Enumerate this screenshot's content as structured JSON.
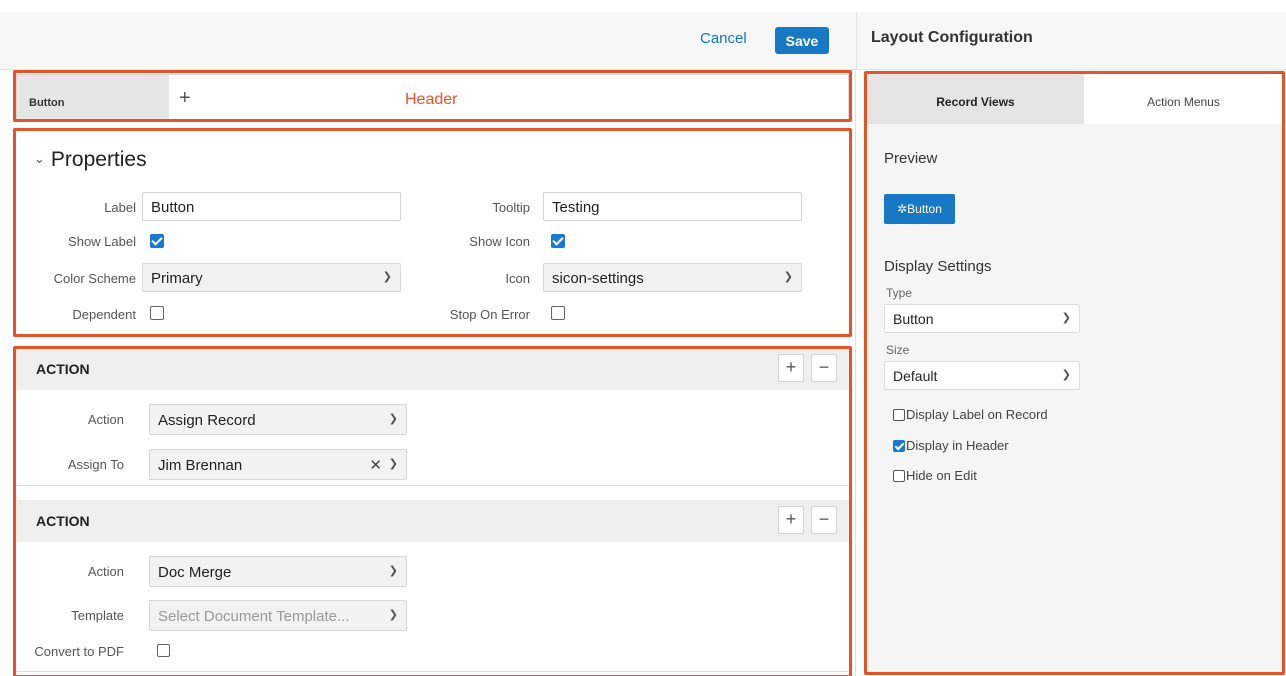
{
  "toolbar": {
    "cancel_label": "Cancel",
    "save_label": "Save"
  },
  "right_panel": {
    "title": "Layout Configuration",
    "tabs": [
      {
        "label": "Record Views",
        "active": true
      },
      {
        "label": "Action Menus",
        "active": false
      }
    ],
    "preview_heading": "Preview",
    "preview_button": {
      "label": "Button",
      "icon": "gear-icon"
    },
    "display_settings_heading": "Display Settings",
    "type_label": "Type",
    "type_value": "Button",
    "size_label": "Size",
    "size_value": "Default",
    "checkboxes": [
      {
        "label": "Display Label on Record",
        "checked": false
      },
      {
        "label": "Display in Header",
        "checked": true
      },
      {
        "label": "Hide on Edit",
        "checked": false
      }
    ]
  },
  "header_row": {
    "tab_label": "Button",
    "add_icon": "plus-icon",
    "annotation": "Header"
  },
  "properties": {
    "title": "Properties",
    "label_label": "Label",
    "label_value": "Button",
    "tooltip_label": "Tooltip",
    "tooltip_value": "Testing",
    "show_label_label": "Show Label",
    "show_label_checked": true,
    "show_icon_label": "Show Icon",
    "show_icon_checked": true,
    "color_scheme_label": "Color Scheme",
    "color_scheme_value": "Primary",
    "icon_label": "Icon",
    "icon_value": "sicon-settings",
    "dependent_label": "Dependent",
    "dependent_checked": false,
    "stop_on_error_label": "Stop On Error",
    "stop_on_error_checked": false
  },
  "actions": [
    {
      "heading": "ACTION",
      "action_label": "Action",
      "action_value": "Assign Record",
      "assign_to_label": "Assign To",
      "assign_to_value": "Jim Brennan"
    },
    {
      "heading": "ACTION",
      "action_label": "Action",
      "action_value": "Doc Merge",
      "template_label": "Template",
      "template_placeholder": "Select Document Template...",
      "convert_label": "Convert to PDF",
      "convert_checked": false
    }
  ],
  "colors": {
    "accent": "#1778c5",
    "highlight": "#e5532b"
  }
}
